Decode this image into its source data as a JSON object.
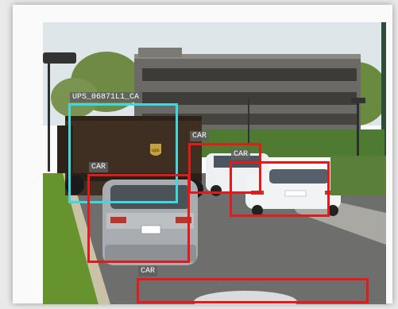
{
  "detections": [
    {
      "label": "UPS_06871L1_CA",
      "color": "#3fd8de"
    },
    {
      "label": "CAR",
      "color": "#e31a1a"
    },
    {
      "label": "CAR",
      "color": "#e31a1a"
    },
    {
      "label": "CAR",
      "color": "#e31a1a"
    },
    {
      "label": "CAR",
      "color": "#e31a1a"
    }
  ],
  "vehicles": {
    "truck_logo": "ups",
    "suv_plate": "",
    "sedan_plate": ""
  }
}
